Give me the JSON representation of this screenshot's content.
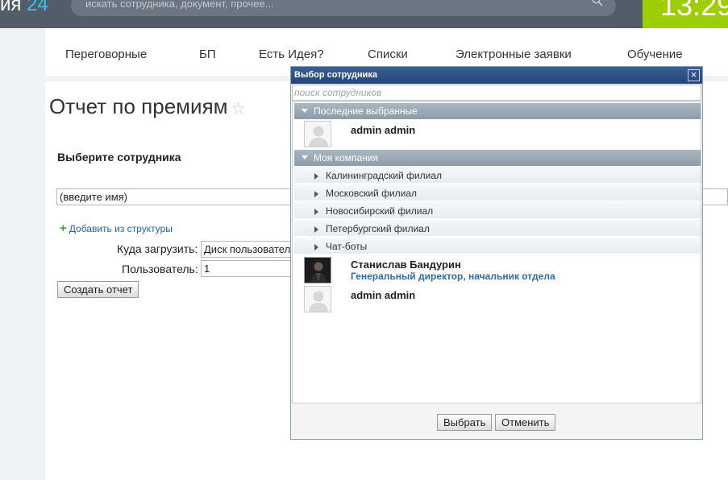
{
  "header": {
    "logo_text": "ия",
    "logo_number": "24",
    "search_placeholder": "искать сотрудника, документ, прочее...",
    "clock": "13:29"
  },
  "nav": {
    "items": [
      "Переговорные",
      "БП",
      "Есть Идея?",
      "Списки",
      "Электронные заявки",
      "Обучение"
    ]
  },
  "page": {
    "title": "Отчет по премиям",
    "star": "☆",
    "choose_employee_label": "Выберите сотрудника",
    "name_input_value": "(введите имя)",
    "add_from_structure": "Добавить из структуры",
    "upload_label": "Куда загрузить:",
    "upload_value": "Диск пользовател",
    "user_label": "Пользователь:",
    "user_value": "1",
    "create_report_button": "Создать отчет"
  },
  "dialog": {
    "title": "Выбор сотрудника",
    "close": "×",
    "search_placeholder": "поиск сотрудников",
    "recent_section": "Последние выбранные",
    "recent_people": [
      {
        "name": "admin admin",
        "position": ""
      }
    ],
    "company_section": "Моя компания",
    "branches": [
      "Калининградский филиал",
      "Московский филиал",
      "Новосибирский филиал",
      "Петербургский филиал",
      "Чат-боты"
    ],
    "company_people": [
      {
        "name": "Станислав Бандурин",
        "position": "Генеральный директор, начальник отдела"
      },
      {
        "name": "admin admin",
        "position": ""
      }
    ],
    "select_button": "Выбрать",
    "cancel_button": "Отменить"
  },
  "colors": {
    "topbar": "#535c69",
    "clock_bg": "#9dcf00",
    "dialog_header": "#23457a",
    "link": "#2067b0"
  }
}
